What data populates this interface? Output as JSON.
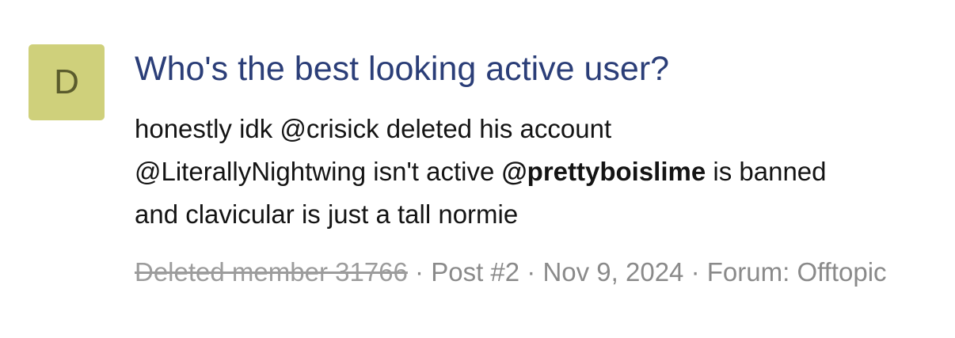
{
  "avatar": {
    "letter": "D",
    "color": "#cfd07b"
  },
  "title": "Who's the best looking active user?",
  "snippet": {
    "part1": "honestly idk @crisick deleted his account @LiterallyNightwing isn't active ",
    "mention_bold": "@prettyboislime",
    "part2": " is banned and clavicular is just a tall normie"
  },
  "meta": {
    "author": "Deleted member 31766",
    "sep1": " · ",
    "post": "Post #2",
    "sep2": " · ",
    "date": "Nov 9, 2024",
    "sep3": " · ",
    "forum_label": "Forum: ",
    "forum": "Offtopic"
  },
  "colors": {
    "title": "#2b3e78",
    "text": "#141414",
    "meta": "#8a8a8a"
  }
}
